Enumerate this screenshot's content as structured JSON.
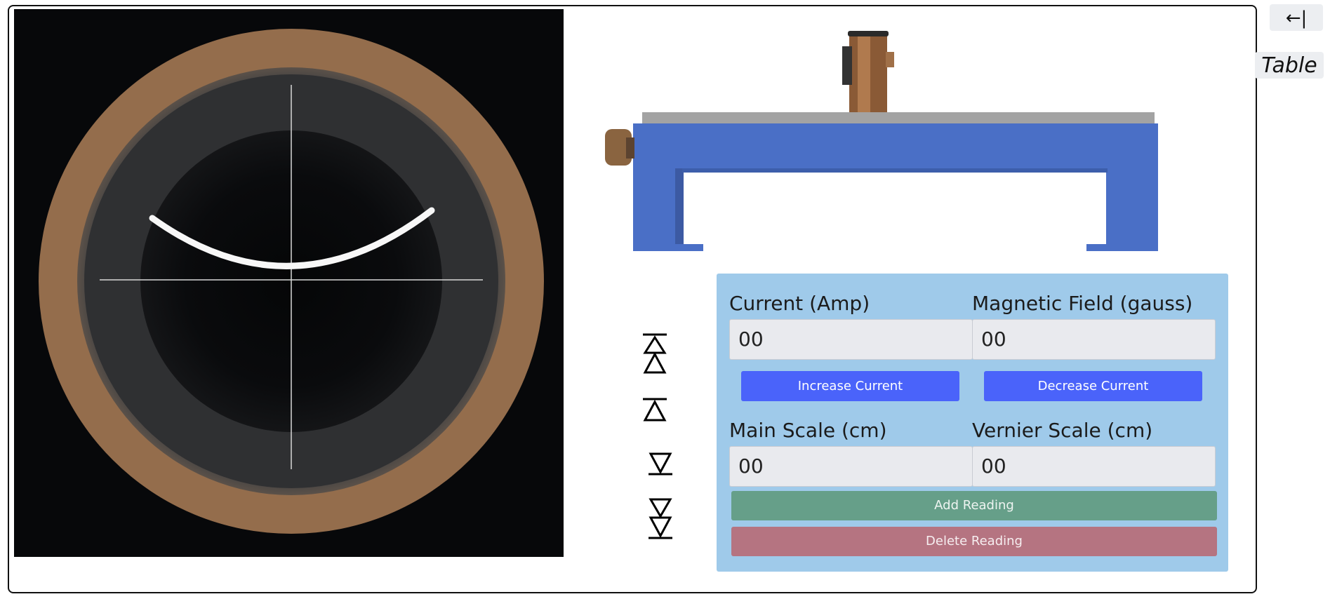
{
  "sidebar": {
    "back_label": "←|",
    "table_label": "Table"
  },
  "controls": {
    "current": {
      "label": "Current (Amp)",
      "value": "00"
    },
    "magnetic_field": {
      "label": "Magnetic Field (gauss)",
      "value": "00"
    },
    "increase_label": "Increase Current",
    "decrease_label": "Decrease Current",
    "main_scale": {
      "label": "Main Scale (cm)",
      "value": "00"
    },
    "vernier_scale": {
      "label": "Vernier Scale (cm)",
      "value": "00"
    },
    "add_label": "Add Reading",
    "delete_label": "Delete Reading"
  },
  "arrows": [
    "fast-up-icon",
    "up-icon",
    "down-icon",
    "fast-down-icon"
  ],
  "colors": {
    "panel": "#9fcaea",
    "button_blue": "#4a63fa",
    "button_green": "#669f89",
    "button_red": "#b57481",
    "ring_brass": "#936d4a",
    "bench_blue": "#4a6fc6"
  }
}
